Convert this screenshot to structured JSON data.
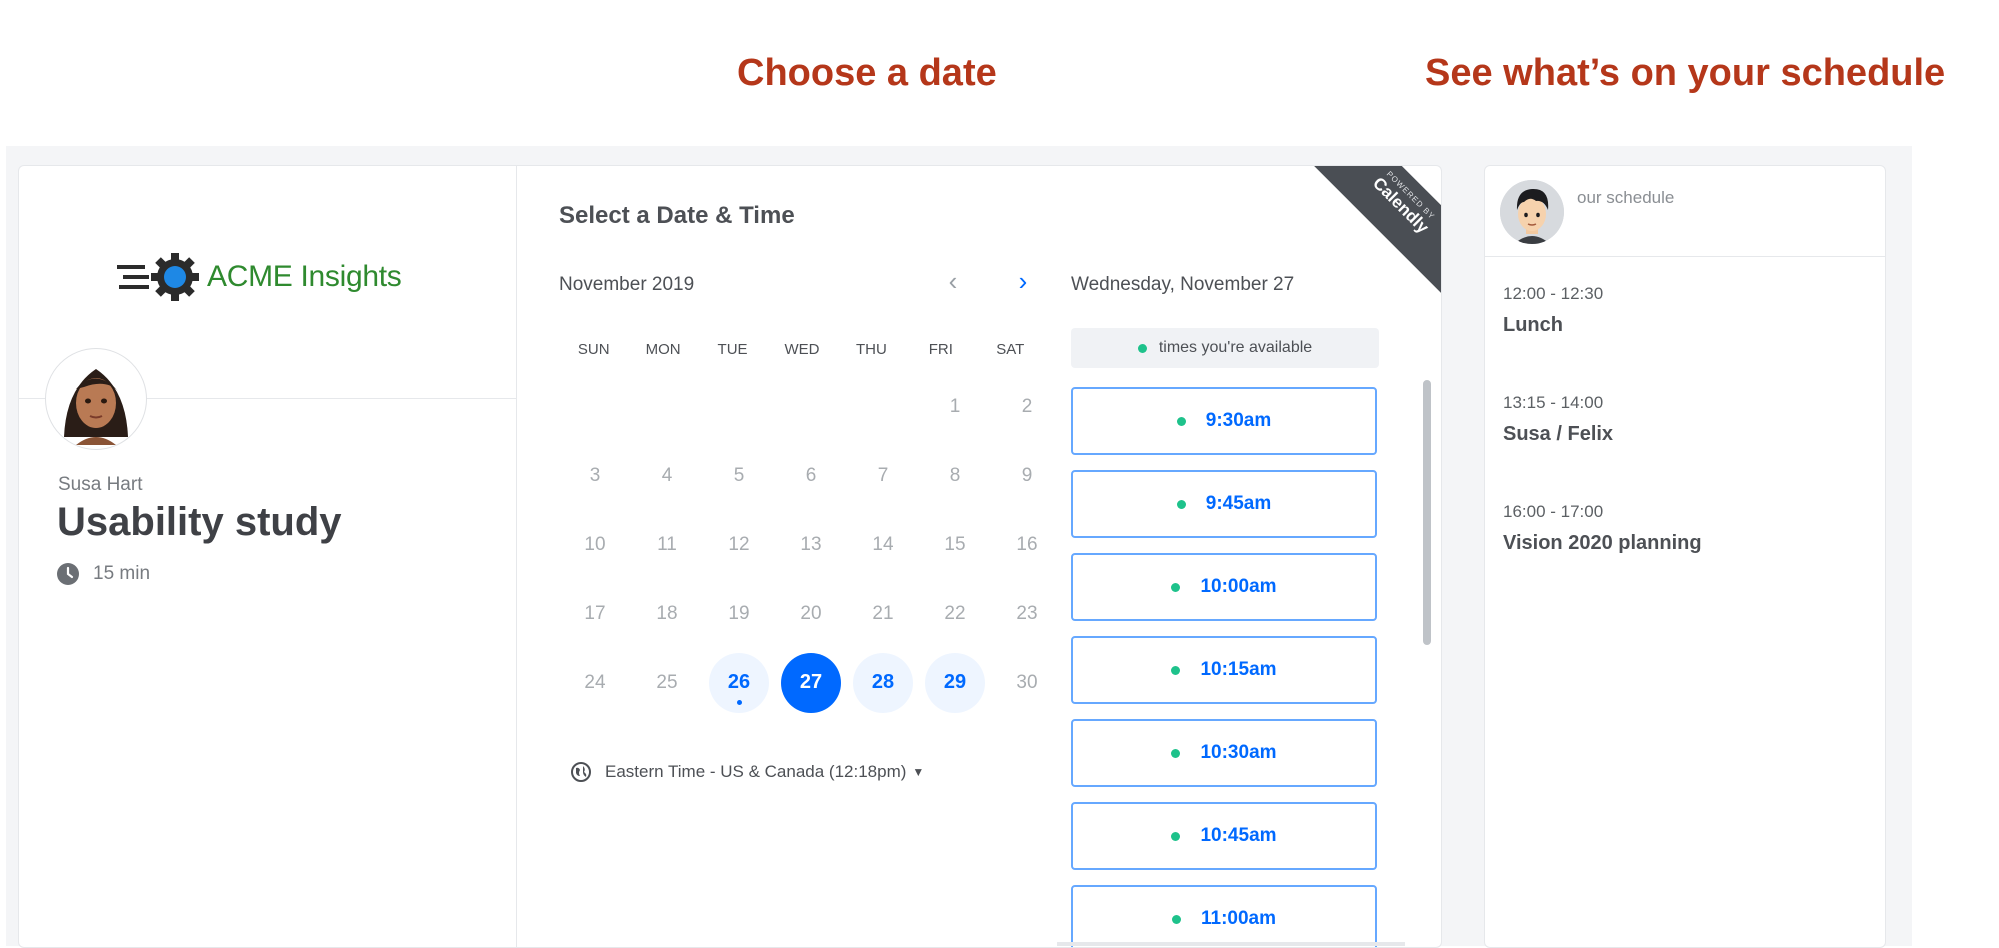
{
  "annotations": {
    "choose_date": "Choose a date",
    "see_schedule": "See what’s on your schedule"
  },
  "brand": {
    "logo_text": "ACME Insights",
    "logo_color": "#2f8a2f"
  },
  "event": {
    "host": "Susa Hart",
    "title": "Usability study",
    "duration": "15 min"
  },
  "calendar": {
    "panel_title": "Select a Date & Time",
    "month": "November 2019",
    "weekdays": [
      "SUN",
      "MON",
      "TUE",
      "WED",
      "THU",
      "FRI",
      "SAT"
    ],
    "days": [
      {
        "label": "",
        "state": "empty"
      },
      {
        "label": "",
        "state": "empty"
      },
      {
        "label": "",
        "state": "empty"
      },
      {
        "label": "",
        "state": "empty"
      },
      {
        "label": "",
        "state": "empty"
      },
      {
        "label": "1",
        "state": "disabled"
      },
      {
        "label": "2",
        "state": "disabled"
      },
      {
        "label": "3",
        "state": "disabled"
      },
      {
        "label": "4",
        "state": "disabled"
      },
      {
        "label": "5",
        "state": "disabled"
      },
      {
        "label": "6",
        "state": "disabled"
      },
      {
        "label": "7",
        "state": "disabled"
      },
      {
        "label": "8",
        "state": "disabled"
      },
      {
        "label": "9",
        "state": "disabled"
      },
      {
        "label": "10",
        "state": "disabled"
      },
      {
        "label": "11",
        "state": "disabled"
      },
      {
        "label": "12",
        "state": "disabled"
      },
      {
        "label": "13",
        "state": "disabled"
      },
      {
        "label": "14",
        "state": "disabled"
      },
      {
        "label": "15",
        "state": "disabled"
      },
      {
        "label": "16",
        "state": "disabled"
      },
      {
        "label": "17",
        "state": "disabled"
      },
      {
        "label": "18",
        "state": "disabled"
      },
      {
        "label": "19",
        "state": "disabled"
      },
      {
        "label": "20",
        "state": "disabled"
      },
      {
        "label": "21",
        "state": "disabled"
      },
      {
        "label": "22",
        "state": "disabled"
      },
      {
        "label": "23",
        "state": "disabled"
      },
      {
        "label": "24",
        "state": "disabled"
      },
      {
        "label": "25",
        "state": "disabled"
      },
      {
        "label": "26",
        "state": "available",
        "today": true
      },
      {
        "label": "27",
        "state": "selected"
      },
      {
        "label": "28",
        "state": "available"
      },
      {
        "label": "29",
        "state": "available"
      },
      {
        "label": "30",
        "state": "disabled"
      }
    ],
    "timezone": "Eastern Time - US & Canada (12:18pm)"
  },
  "times": {
    "date_heading": "Wednesday, November 27",
    "legend": "times you're available",
    "slots": [
      "9:30am",
      "9:45am",
      "10:00am",
      "10:15am",
      "10:30am",
      "10:45am",
      "11:00am"
    ]
  },
  "badge": {
    "line1": "POWERED BY",
    "line2": "Calendly"
  },
  "schedule": {
    "label": "our schedule",
    "events": [
      {
        "time": "12:00 - 12:30",
        "title": "Lunch"
      },
      {
        "time": "13:15 - 14:00",
        "title": "Susa / Felix"
      },
      {
        "time": "16:00 - 17:00",
        "title": "Vision 2020 planning"
      }
    ]
  },
  "colors": {
    "accent": "#0069ff",
    "available_dot": "#1ec28b",
    "annotation": "#b5371a"
  }
}
